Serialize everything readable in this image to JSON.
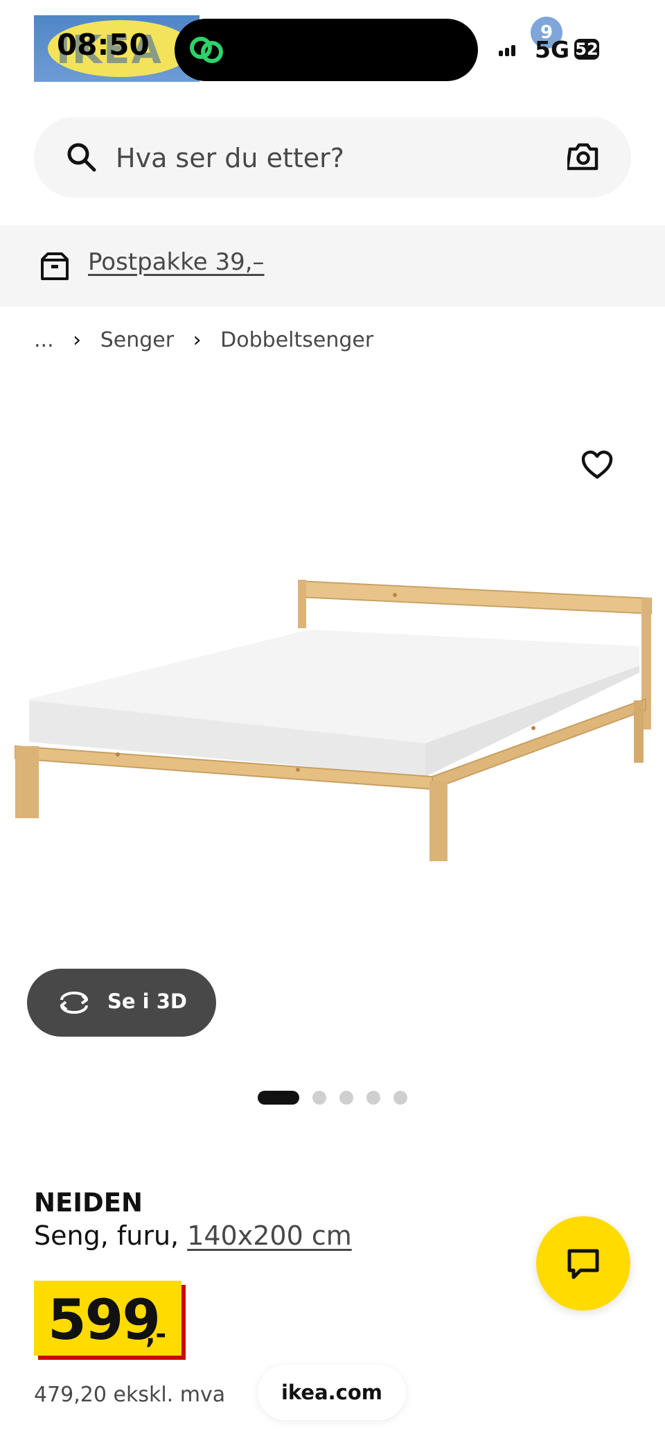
{
  "status_bar": {
    "time": "08:50",
    "network": "5G",
    "battery": "52",
    "notification_count": "9"
  },
  "brand": {
    "logo_text": "IKEA"
  },
  "search": {
    "placeholder": "Hva ser du etter?",
    "icon": "search-icon",
    "camera_icon": "camera-icon"
  },
  "promo": {
    "icon": "parcel-box-icon",
    "link_text": "Postpakke 39,–"
  },
  "breadcrumb": {
    "ellipsis": "...",
    "items": [
      "Senger",
      "Dobbeltsenger"
    ]
  },
  "gallery": {
    "favorite_icon": "heart-icon",
    "view_3d_label": "Se i 3D",
    "view_3d_icon": "rotate-icon",
    "image_count": 5,
    "active_index": 0
  },
  "product": {
    "name": "NEIDEN",
    "description_prefix": "Seng, furu, ",
    "size_link": "140x200 cm",
    "price_main": "599",
    "price_suffix": ",-",
    "price_ex_vat": "479,20 ekskl. mva"
  },
  "chat": {
    "icon": "chat-bubble-icon"
  },
  "browser": {
    "domain": "ikea.com"
  },
  "colors": {
    "price_bg": "#ffdb00",
    "price_shadow": "#cc0008",
    "chat_bg": "#ffdb00",
    "button_3d_bg": "#484848",
    "promo_bg": "#f5f5f5"
  }
}
